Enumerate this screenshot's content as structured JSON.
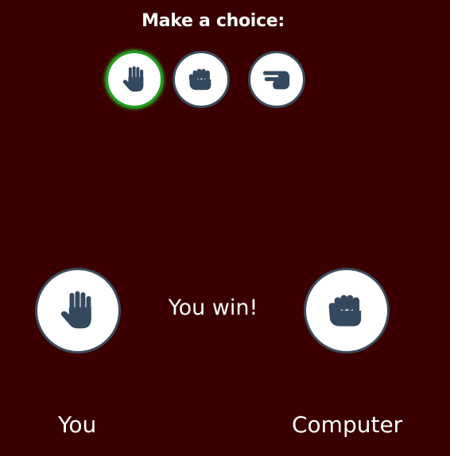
{
  "prompt": "Make a choice:",
  "choices": [
    {
      "id": "paper",
      "icon": "open-hand-icon",
      "selected": true
    },
    {
      "id": "rock",
      "icon": "fist-icon",
      "selected": false
    },
    {
      "id": "scissors",
      "icon": "scissors-hand-icon",
      "selected": false
    }
  ],
  "result": "You win!",
  "player": {
    "label": "You",
    "choice_icon": "open-hand-icon"
  },
  "computer": {
    "label": "Computer",
    "choice_icon": "fist-icon"
  },
  "colors": {
    "background": "#3a0000",
    "icon": "#34495e",
    "selected_border": "#1f9e1f",
    "circle_border": "#3c4a5c"
  }
}
